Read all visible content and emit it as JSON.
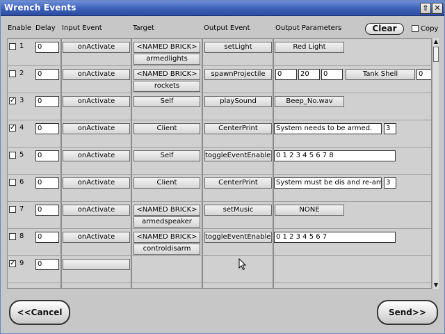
{
  "window": {
    "title": "Wrench Events"
  },
  "headers": {
    "enable": "Enable",
    "delay": "Delay",
    "input_event": "Input Event",
    "target": "Target",
    "output_event": "Output Event",
    "output_parameters": "Output Parameters",
    "clear": "Clear",
    "copy": "Copy"
  },
  "rows": [
    {
      "num": "1",
      "checked": false,
      "delay": "0",
      "input": "onActivate",
      "target": "<NAMED BRICK>",
      "target_name": "armedlights",
      "output": "setLight",
      "params_button": "Red Light"
    },
    {
      "num": "2",
      "checked": false,
      "delay": "0",
      "input": "onActivate",
      "target": "<NAMED BRICK>",
      "target_name": "rockets",
      "output": "spawnProjectile",
      "p1": "0",
      "p2": "20",
      "p3": "0",
      "params_button": "Tank Shell",
      "p4": "0"
    },
    {
      "num": "3",
      "checked": true,
      "delay": "0",
      "input": "onActivate",
      "target": "Self",
      "output": "playSound",
      "params_button": "Beep_No.wav"
    },
    {
      "num": "4",
      "checked": true,
      "delay": "0",
      "input": "onActivate",
      "target": "Client",
      "output": "CenterPrint",
      "text": "System needs to be armed.",
      "num_param": "3"
    },
    {
      "num": "5",
      "checked": false,
      "delay": "0",
      "input": "onActivate",
      "target": "Self",
      "output": "toggleEventEnabled",
      "text": "0 1 2 3 4 5 6 7 8"
    },
    {
      "num": "6",
      "checked": false,
      "delay": "0",
      "input": "onActivate",
      "target": "Client",
      "output": "CenterPrint",
      "text": "System must be dis and re-armed",
      "num_param": "3"
    },
    {
      "num": "7",
      "checked": false,
      "delay": "0",
      "input": "onActivate",
      "target": "<NAMED BRICK>",
      "target_name": "armedspeaker",
      "output": "setMusic",
      "params_button": "NONE"
    },
    {
      "num": "8",
      "checked": false,
      "delay": "0",
      "input": "onActivate",
      "target": "<NAMED BRICK>",
      "target_name": "controldisarm",
      "output": "toggleEventEnabled",
      "text": "0 1 2 3 4 5 6 7"
    },
    {
      "num": "9",
      "checked": true,
      "delay": "0",
      "input": ""
    }
  ],
  "footer": {
    "cancel": "<<Cancel",
    "send": "Send>>"
  },
  "colors": {
    "titlebar": "#3b5fb8",
    "panel": "#c7c7c7",
    "list_bg": "#d0d0d0"
  }
}
